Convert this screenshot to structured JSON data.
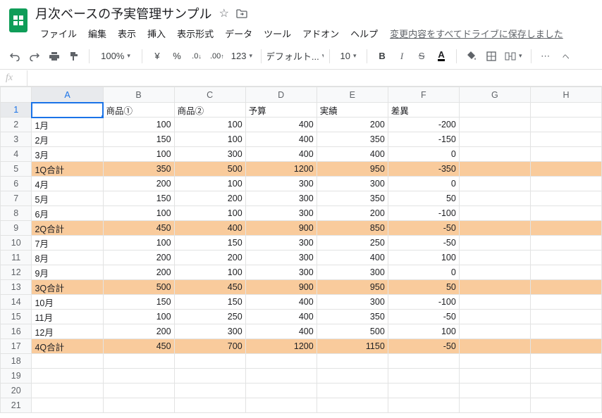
{
  "doc": {
    "title": "月次ベースの予実管理サンプル",
    "save_status": "変更内容をすべてドライブに保存しました"
  },
  "menus": {
    "file": "ファイル",
    "edit": "編集",
    "view": "表示",
    "insert": "挿入",
    "format": "表示形式",
    "data": "データ",
    "tools": "ツール",
    "addons": "アドオン",
    "help": "ヘルプ"
  },
  "toolbar": {
    "zoom": "100%",
    "currency": "¥",
    "percent": "%",
    "dec_dec": ".0",
    "dec_inc": ".00",
    "numfmt": "123",
    "font": "デフォルト...",
    "font_size": "10",
    "bold": "B",
    "italic": "I",
    "strike": "S",
    "textcolor": "A"
  },
  "formula": {
    "fx": "fx",
    "value": ""
  },
  "columns": [
    "A",
    "B",
    "C",
    "D",
    "E",
    "F",
    "G",
    "H"
  ],
  "header_row": {
    "A": "",
    "B": "商品①",
    "C": "商品②",
    "D": "予算",
    "E": "実績",
    "F": "差異"
  },
  "rows": [
    {
      "n": 1,
      "hl": false,
      "A": "",
      "B": "商品①",
      "C": "商品②",
      "D": "予算",
      "E": "実績",
      "F": "差異",
      "is_header": true
    },
    {
      "n": 2,
      "hl": false,
      "A": "1月",
      "B": "100",
      "C": "100",
      "D": "400",
      "E": "200",
      "F": "-200"
    },
    {
      "n": 3,
      "hl": false,
      "A": "2月",
      "B": "150",
      "C": "100",
      "D": "400",
      "E": "350",
      "F": "-150"
    },
    {
      "n": 4,
      "hl": false,
      "A": "3月",
      "B": "100",
      "C": "300",
      "D": "400",
      "E": "400",
      "F": "0"
    },
    {
      "n": 5,
      "hl": true,
      "A": "1Q合計",
      "B": "350",
      "C": "500",
      "D": "1200",
      "E": "950",
      "F": "-350"
    },
    {
      "n": 6,
      "hl": false,
      "A": "4月",
      "B": "200",
      "C": "100",
      "D": "300",
      "E": "300",
      "F": "0"
    },
    {
      "n": 7,
      "hl": false,
      "A": "5月",
      "B": "150",
      "C": "200",
      "D": "300",
      "E": "350",
      "F": "50"
    },
    {
      "n": 8,
      "hl": false,
      "A": "6月",
      "B": "100",
      "C": "100",
      "D": "300",
      "E": "200",
      "F": "-100"
    },
    {
      "n": 9,
      "hl": true,
      "A": "2Q合計",
      "B": "450",
      "C": "400",
      "D": "900",
      "E": "850",
      "F": "-50"
    },
    {
      "n": 10,
      "hl": false,
      "A": "7月",
      "B": "100",
      "C": "150",
      "D": "300",
      "E": "250",
      "F": "-50"
    },
    {
      "n": 11,
      "hl": false,
      "A": "8月",
      "B": "200",
      "C": "200",
      "D": "300",
      "E": "400",
      "F": "100"
    },
    {
      "n": 12,
      "hl": false,
      "A": "9月",
      "B": "200",
      "C": "100",
      "D": "300",
      "E": "300",
      "F": "0"
    },
    {
      "n": 13,
      "hl": true,
      "A": "3Q合計",
      "B": "500",
      "C": "450",
      "D": "900",
      "E": "950",
      "F": "50"
    },
    {
      "n": 14,
      "hl": false,
      "A": "10月",
      "B": "150",
      "C": "150",
      "D": "400",
      "E": "300",
      "F": "-100"
    },
    {
      "n": 15,
      "hl": false,
      "A": "11月",
      "B": "100",
      "C": "250",
      "D": "400",
      "E": "350",
      "F": "-50"
    },
    {
      "n": 16,
      "hl": false,
      "A": "12月",
      "B": "200",
      "C": "300",
      "D": "400",
      "E": "500",
      "F": "100"
    },
    {
      "n": 17,
      "hl": true,
      "A": "4Q合計",
      "B": "450",
      "C": "700",
      "D": "1200",
      "E": "1150",
      "F": "-50"
    },
    {
      "n": 18,
      "hl": false
    },
    {
      "n": 19,
      "hl": false
    },
    {
      "n": 20,
      "hl": false
    },
    {
      "n": 21,
      "hl": false
    }
  ]
}
